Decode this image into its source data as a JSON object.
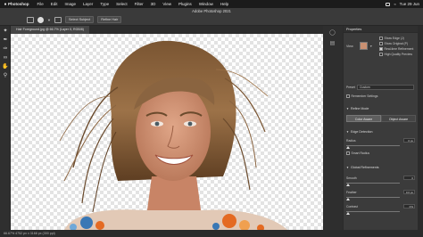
{
  "menubar": {
    "app_name": "Photoshop",
    "items": [
      "File",
      "Edit",
      "Image",
      "Layer",
      "Type",
      "Select",
      "Filter",
      "3D",
      "View",
      "Plugins",
      "Window",
      "Help"
    ],
    "clock": "Tue 29 Jun"
  },
  "window": {
    "title": "Adobe Photoshop 2021"
  },
  "options_bar": {
    "select_subject_label": "Select Subject",
    "refine_hair_label": "Refine Hair"
  },
  "document": {
    "tab_label": "Hair Foreground.jpg @ 66.7% (Layer 0, RGB/8)"
  },
  "status_bar": {
    "text": "66.67%   4752 px x 3168 px (300 ppi)"
  },
  "properties": {
    "header": "Properties",
    "view_label": "View",
    "show_edge": "Show Edge (J)",
    "show_original": "Show Original (P)",
    "real_time_refinement": "Real-time Refinement",
    "high_quality_preview": "High Quality Preview",
    "preset_label": "Preset",
    "preset_value": "Custom",
    "remember_settings": "Remember Settings",
    "refine_mode": "Refine Mode",
    "color_aware": "Color Aware",
    "object_aware": "Object Aware",
    "edge_detection": "Edge Detection",
    "radius_label": "Radius",
    "radius_value": "0 px",
    "smart_radius": "Smart Radius",
    "global_refinements": "Global Refinements",
    "smooth_label": "Smooth",
    "smooth_value": "0",
    "feather_label": "Feather",
    "feather_value": "0.0 px",
    "contrast_label": "Contrast",
    "contrast_value": "0%"
  },
  "colors": {
    "panel": "#3b3b3b",
    "canvas_check": "#e3e3e3",
    "menubar": "#1b1b1b"
  }
}
